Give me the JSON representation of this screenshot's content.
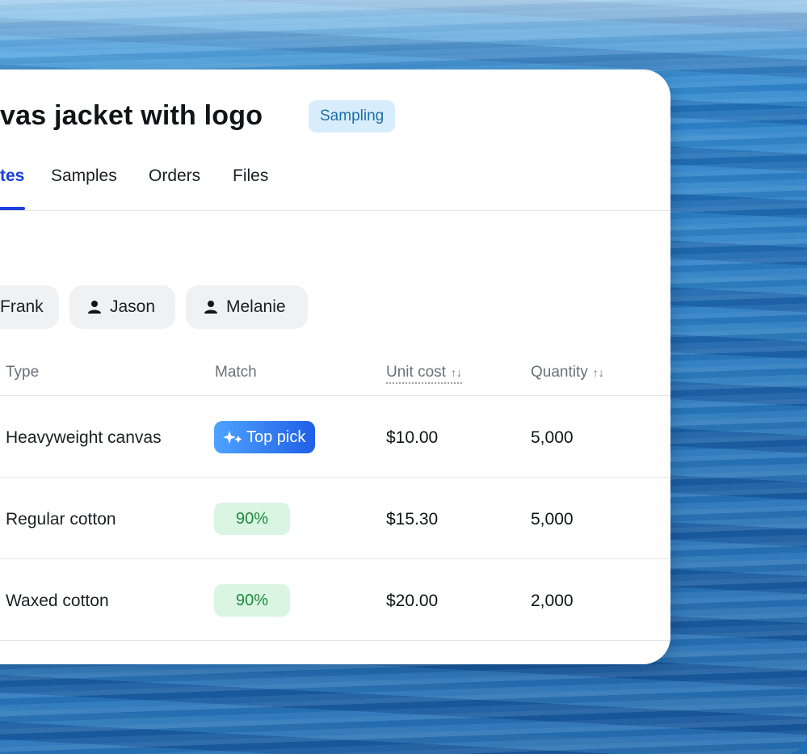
{
  "header": {
    "title": "vas jacket with logo",
    "status_badge": "Sampling"
  },
  "tabs": [
    {
      "label": "tes",
      "active": true
    },
    {
      "label": "Samples",
      "active": false
    },
    {
      "label": "Orders",
      "active": false
    },
    {
      "label": "Files",
      "active": false
    }
  ],
  "filters": {
    "chips": [
      "Frank",
      "Jason",
      "Melanie"
    ]
  },
  "table": {
    "columns": [
      {
        "label": "Type"
      },
      {
        "label": "Match"
      },
      {
        "label": "Unit cost",
        "sort_icon": "↑↓"
      },
      {
        "label": "Quantity",
        "sort_icon": "↑↓"
      }
    ],
    "rows": [
      {
        "type": "Heavyweight canvas",
        "match": "Top pick",
        "match_kind": "top-pick",
        "unit_cost": "$10.00",
        "quantity": "5,000"
      },
      {
        "type": "Regular cotton",
        "match": "90%",
        "match_kind": "percent",
        "unit_cost": "$15.30",
        "quantity": "5,000"
      },
      {
        "type": "Waxed cotton",
        "match": "90%",
        "match_kind": "percent",
        "unit_cost": "$20.00",
        "quantity": "2,000"
      }
    ]
  },
  "colors": {
    "accent": "#1f3ee0",
    "badge_bg": "#d7edfb",
    "match_green_bg": "#daf5e2",
    "match_green_text": "#1f8a3e",
    "top_pick_gradient": [
      "#4ea3ff",
      "#1f5fe6"
    ]
  },
  "icons": {
    "chip_icon": "person-icon",
    "top_pick_icon": "sparkle-icon",
    "sort_icon": "sort-arrows-icon"
  }
}
